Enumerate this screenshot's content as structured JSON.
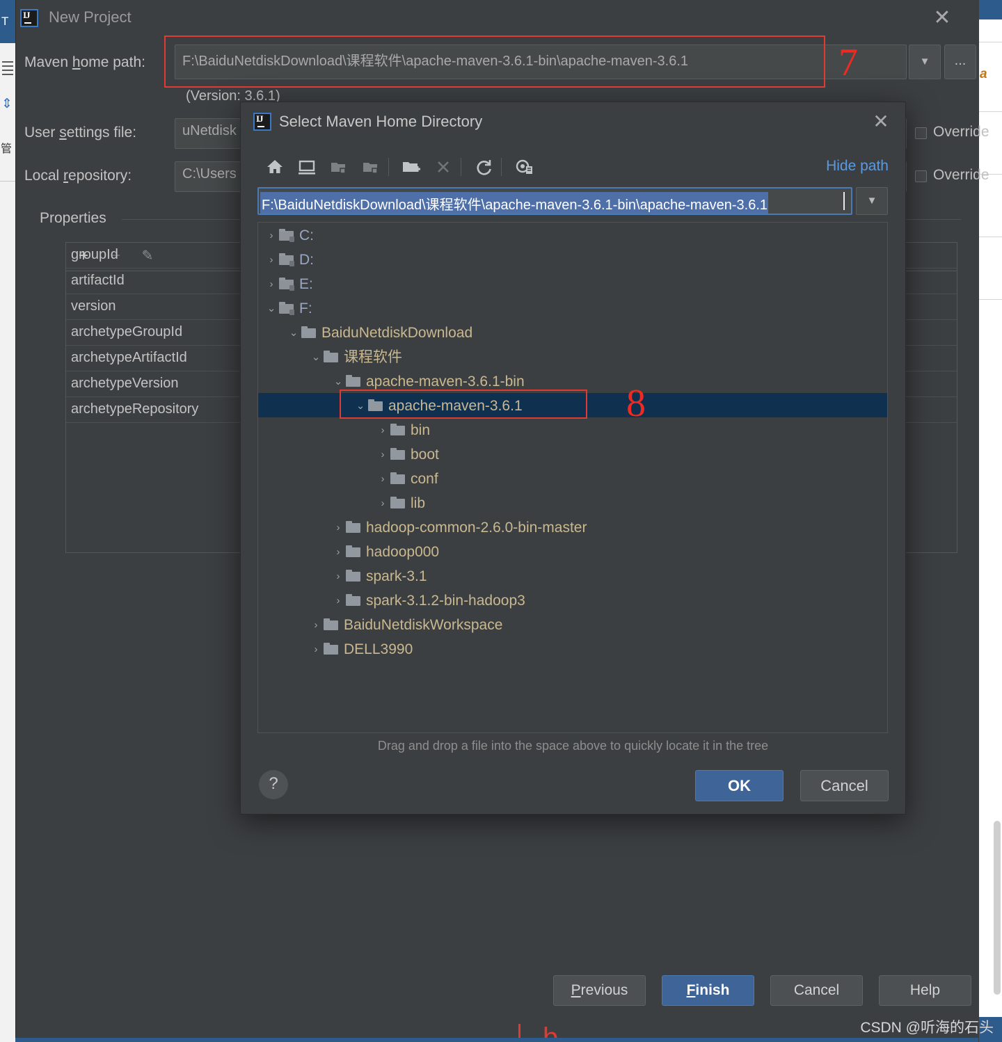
{
  "ide": {
    "left_strip": {
      "tab_letter": "T",
      "cjk_label": "管"
    },
    "right_strip": {
      "glyph": "a"
    }
  },
  "new_project": {
    "title": "New Project",
    "close_label": "✕",
    "maven_home": {
      "label_pre": "Maven ",
      "label_key": "h",
      "label_post": "ome path:",
      "value": "F:\\BaiduNetdiskDownload\\课程软件\\apache-maven-3.6.1-bin\\apache-maven-3.6.1",
      "dropdown_arrow": "▼",
      "browse_label": "...",
      "version_note": "(Version: 3.6.1)"
    },
    "user_settings": {
      "label_pre": "User ",
      "label_key": "s",
      "label_post": "ettings file:",
      "value": "uNetdisk",
      "override_label": "Override"
    },
    "local_repository": {
      "label_pre": "Local ",
      "label_key": "r",
      "label_post": "epository:",
      "value": "C:\\Users",
      "override_label": "Override"
    },
    "properties": {
      "section_title": "Properties",
      "toolbar": {
        "add": "+",
        "remove": "−",
        "edit": "✎"
      },
      "rows": [
        "groupId",
        "artifactId",
        "version",
        "archetypeGroupId",
        "archetypeArtifactId",
        "archetypeVersion",
        "archetypeRepository"
      ]
    },
    "buttons": {
      "previous_pre": "",
      "previous_key": "P",
      "previous_post": "revious",
      "finish_key": "F",
      "finish_post": "inish",
      "cancel": "Cancel",
      "help": "Help"
    }
  },
  "maven_dialog": {
    "title": "Select Maven Home Directory",
    "close_label": "✕",
    "hide_path": "Hide path",
    "path_value": "F:\\BaiduNetdiskDownload\\课程软件\\apache-maven-3.6.1-bin\\apache-maven-3.6.1",
    "path_dropdown_arrow": "▼",
    "toolbar_icons": [
      "home-icon",
      "desktop-icon",
      "expand-all-icon",
      "collapse-all-icon",
      "new-folder-icon",
      "delete-icon",
      "refresh-icon",
      "show-hidden-files-icon"
    ],
    "tree": [
      {
        "label": "C:",
        "indent": 0,
        "chevron": "›",
        "type": "drive",
        "expanded": false,
        "selected": false
      },
      {
        "label": "D:",
        "indent": 0,
        "chevron": "›",
        "type": "drive",
        "expanded": false,
        "selected": false
      },
      {
        "label": "E:",
        "indent": 0,
        "chevron": "›",
        "type": "drive",
        "expanded": false,
        "selected": false
      },
      {
        "label": "F:",
        "indent": 0,
        "chevron": "⌄",
        "type": "drive",
        "expanded": true,
        "selected": false
      },
      {
        "label": "BaiduNetdiskDownload",
        "indent": 1,
        "chevron": "⌄",
        "type": "folder",
        "expanded": true,
        "selected": false
      },
      {
        "label": "课程软件",
        "indent": 2,
        "chevron": "⌄",
        "type": "folder",
        "expanded": true,
        "selected": false
      },
      {
        "label": "apache-maven-3.6.1-bin",
        "indent": 3,
        "chevron": "⌄",
        "type": "folder",
        "expanded": true,
        "selected": false
      },
      {
        "label": "apache-maven-3.6.1",
        "indent": 4,
        "chevron": "⌄",
        "type": "folder",
        "expanded": true,
        "selected": true
      },
      {
        "label": "bin",
        "indent": 5,
        "chevron": "›",
        "type": "folder",
        "expanded": false,
        "selected": false
      },
      {
        "label": "boot",
        "indent": 5,
        "chevron": "›",
        "type": "folder",
        "expanded": false,
        "selected": false
      },
      {
        "label": "conf",
        "indent": 5,
        "chevron": "›",
        "type": "folder",
        "expanded": false,
        "selected": false
      },
      {
        "label": "lib",
        "indent": 5,
        "chevron": "›",
        "type": "folder",
        "expanded": false,
        "selected": false
      },
      {
        "label": "hadoop-common-2.6.0-bin-master",
        "indent": 3,
        "chevron": "›",
        "type": "folder",
        "expanded": false,
        "selected": false
      },
      {
        "label": "hadoop000",
        "indent": 3,
        "chevron": "›",
        "type": "folder",
        "expanded": false,
        "selected": false
      },
      {
        "label": "spark-3.1",
        "indent": 3,
        "chevron": "›",
        "type": "folder",
        "expanded": false,
        "selected": false
      },
      {
        "label": "spark-3.1.2-bin-hadoop3",
        "indent": 3,
        "chevron": "›",
        "type": "folder",
        "expanded": false,
        "selected": false
      },
      {
        "label": "BaiduNetdiskWorkspace",
        "indent": 2,
        "chevron": "›",
        "type": "folder",
        "expanded": false,
        "selected": false
      },
      {
        "label": "DELL3990",
        "indent": 2,
        "chevron": "›",
        "type": "folder",
        "expanded": false,
        "selected": false
      }
    ],
    "hint": "Drag and drop a file into the space above to quickly locate it in the tree",
    "help_label": "?",
    "ok_label": "OK",
    "cancel_label": "Cancel"
  },
  "annotations": {
    "step7": "7",
    "step8": "8",
    "partial_bottom": "b",
    "accent_color": "#ee2a22"
  },
  "watermark": "CSDN @听海的石头"
}
